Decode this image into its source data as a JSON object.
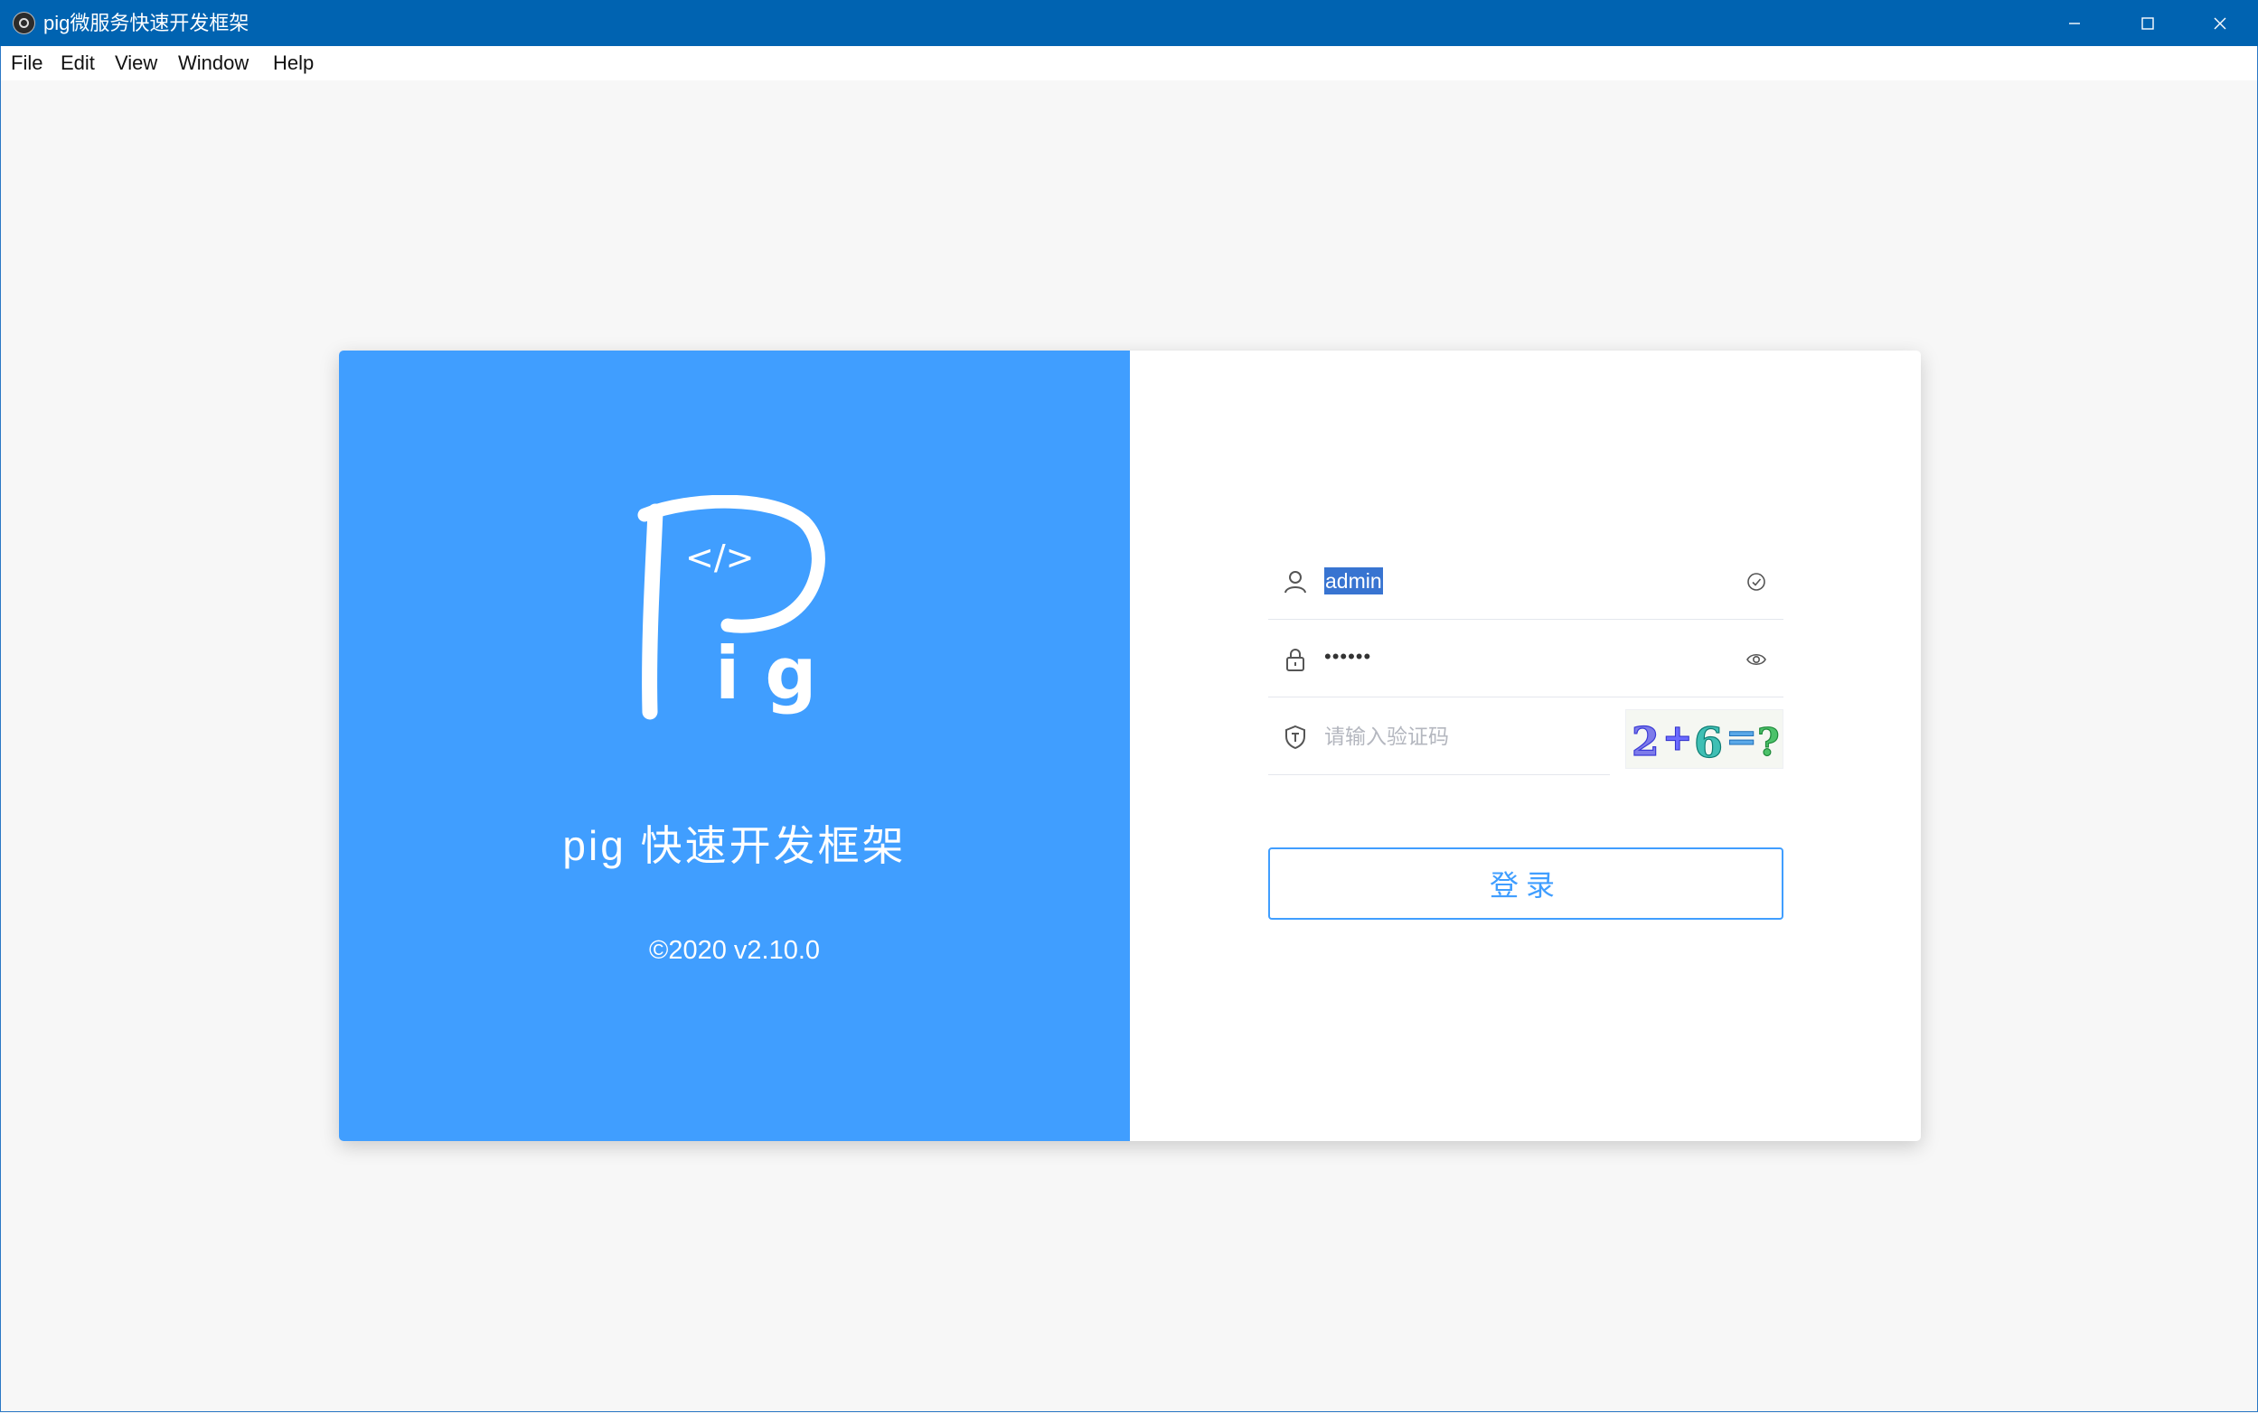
{
  "window": {
    "title": "pig微服务快速开发框架"
  },
  "menu": {
    "items": [
      "File",
      "Edit",
      "View",
      "Window",
      "Help"
    ]
  },
  "brand": {
    "logo_text": "Pig",
    "logo_code": "</>",
    "title": "pig 快速开发框架",
    "version": "©2020 v2.10.0"
  },
  "form": {
    "username": "admin",
    "password_masked": "••••••",
    "captcha_placeholder": "请输入验证码",
    "captcha_text": "2+6=?",
    "login_label": "登录"
  },
  "colors": {
    "accent": "#409eff",
    "titlebar": "#0063b1",
    "selection": "#3874d1"
  },
  "icons": {
    "user": "user-icon",
    "lock": "lock-icon",
    "shield": "shield-icon",
    "valid": "check-circle-icon",
    "show_password": "eye-icon"
  }
}
